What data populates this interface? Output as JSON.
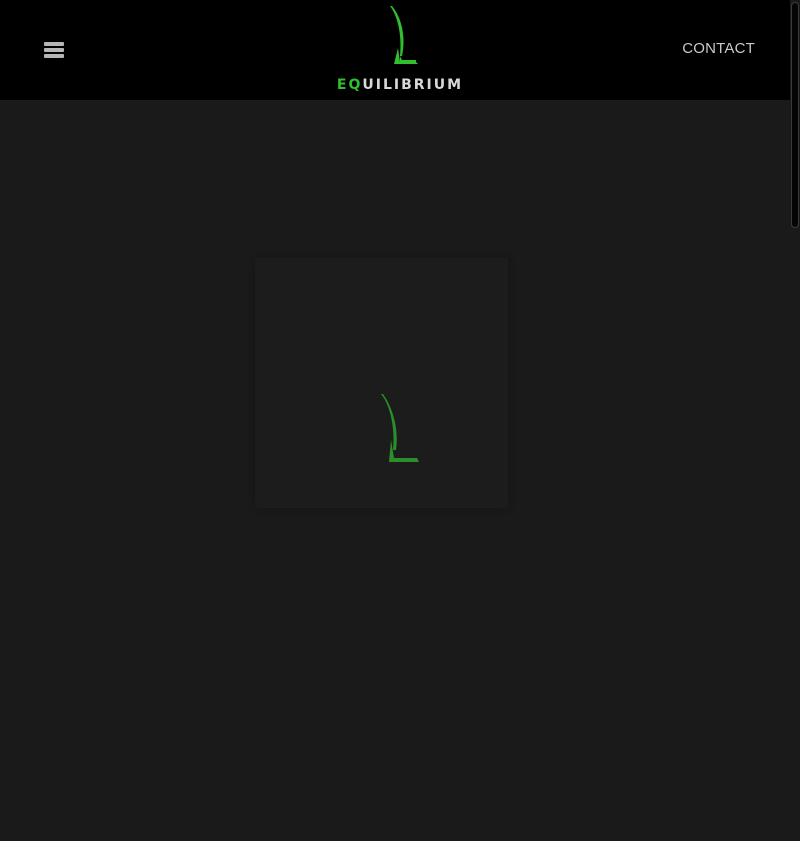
{
  "header": {
    "menu_icon": "hamburger-menu-icon",
    "logo": {
      "accent_text": "EQ",
      "rest_text": "UILIBRIUM",
      "mark_icon": "leaf-swoosh-icon"
    },
    "contact_label": "CONTACT"
  },
  "main": {
    "loader_icon": "leaf-swoosh-icon"
  },
  "colors": {
    "header_background": "#000000",
    "page_background": "#1a1a1a",
    "brand_green": "#2fbf2f",
    "nav_text": "#c9c9c9"
  }
}
